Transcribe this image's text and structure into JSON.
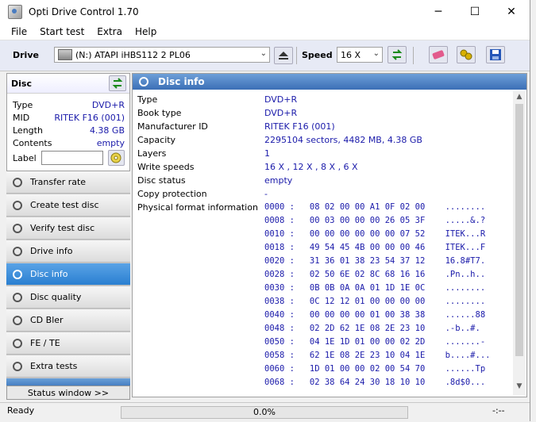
{
  "window": {
    "title": "Opti Drive Control 1.70"
  },
  "window_controls": {
    "minimize": "─",
    "maximize": "☐",
    "close": "✕"
  },
  "menu": [
    "File",
    "Start test",
    "Extra",
    "Help"
  ],
  "toolbar": {
    "drive_label": "Drive",
    "drive_value": "(N:)   ATAPI iHBS112   2 PL06",
    "speed_label": "Speed",
    "speed_value": "16 X"
  },
  "disc_panel": {
    "title": "Disc",
    "rows": [
      {
        "key": "Type",
        "value": "DVD+R"
      },
      {
        "key": "MID",
        "value": "RITEK F16 (001)"
      },
      {
        "key": "Length",
        "value": "4.38 GB"
      },
      {
        "key": "Contents",
        "value": "empty"
      }
    ],
    "label_key": "Label"
  },
  "nav": [
    {
      "label": "Transfer rate",
      "active": false
    },
    {
      "label": "Create test disc",
      "active": false
    },
    {
      "label": "Verify test disc",
      "active": false
    },
    {
      "label": "Drive info",
      "active": false
    },
    {
      "label": "Disc info",
      "active": true
    },
    {
      "label": "Disc quality",
      "active": false
    },
    {
      "label": "CD Bler",
      "active": false
    },
    {
      "label": "FE / TE",
      "active": false
    },
    {
      "label": "Extra tests",
      "active": false
    }
  ],
  "status_window_button": "Status window >>",
  "main": {
    "title": "Disc info",
    "rows": [
      {
        "key": "Type",
        "value": "DVD+R"
      },
      {
        "key": "Book type",
        "value": "DVD+R"
      },
      {
        "key": "Manufacturer ID",
        "value": "RITEK F16 (001)"
      },
      {
        "key": "Capacity",
        "value": "2295104 sectors, 4482 MB, 4.38 GB"
      },
      {
        "key": "Layers",
        "value": "1"
      },
      {
        "key": "Write speeds",
        "value": "16 X , 12 X , 8 X , 6 X"
      },
      {
        "key": "Disc status",
        "value": "empty"
      },
      {
        "key": "Copy protection",
        "value": "-"
      },
      {
        "key": "Physical format information",
        "value": ""
      }
    ],
    "hex": [
      "0000 :   08 02 00 00 A1 0F 02 00    ........",
      "0008 :   00 03 00 00 00 26 05 3F    .....&.?",
      "0010 :   00 00 00 00 00 00 07 52    ITEK...R",
      "0018 :   49 54 45 4B 00 00 00 46    ITEK...F",
      "0020 :   31 36 01 38 23 54 37 12    16.8#T7.",
      "0028 :   02 50 6E 02 8C 68 16 16    .Pn..h..",
      "0030 :   0B 0B 0A 0A 01 1D 1E 0C    ........",
      "0038 :   0C 12 12 01 00 00 00 00    ........",
      "0040 :   00 00 00 00 01 00 38 38    ......88",
      "0048 :   02 2D 62 1E 08 2E 23 10    .-b..#.",
      "0050 :   04 1E 1D 01 00 00 02 2D    .......-",
      "0058 :   62 1E 08 2E 23 10 04 1E    b....#...",
      "0060 :   1D 01 00 00 02 00 54 70    ......Tp",
      "0068 :   02 38 64 24 30 18 10 10    .8d$0..."
    ]
  },
  "statusbar": {
    "text": "Ready",
    "progress_text": "0.0%",
    "progress_fraction": 0.0,
    "time": "-:--"
  }
}
